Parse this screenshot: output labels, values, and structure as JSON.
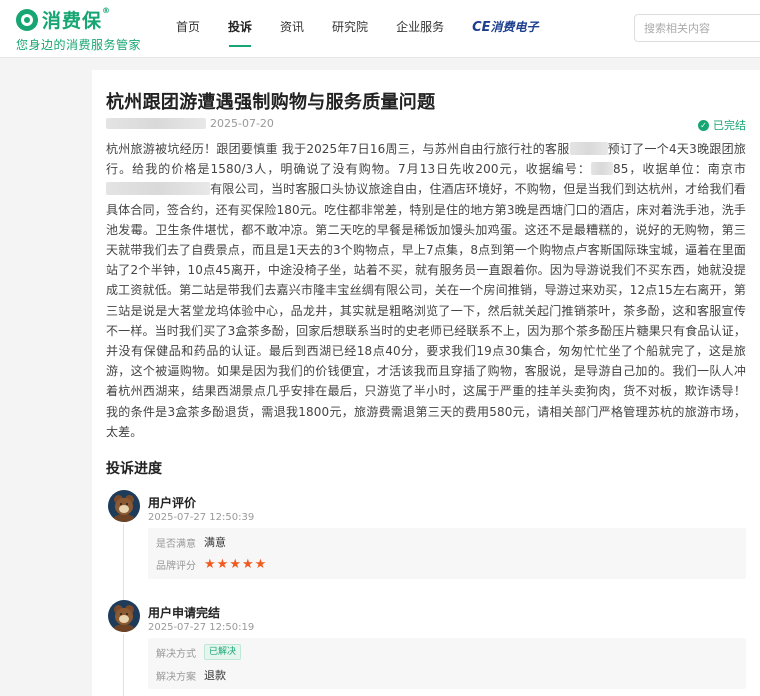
{
  "header": {
    "brand_name": "消费保",
    "brand_reg": "®",
    "slogan": "您身边的消费服务管家",
    "nav": [
      {
        "label": "首页"
      },
      {
        "label": "投诉"
      },
      {
        "label": "资讯"
      },
      {
        "label": "研究院"
      },
      {
        "label": "企业服务"
      }
    ],
    "nav_brand_ce": "CE",
    "nav_brand_label": "消费电子",
    "search_placeholder": "搜索相关内容"
  },
  "complaint": {
    "title": "杭州跟团游遭遇强制购物与服务质量问题",
    "date": "2025-07-20",
    "status": "已完结",
    "content": {
      "p1": "杭州旅游被坑经历！跟团要慎重 我于2025年7日16周三，与苏州自由行旅行社的客服",
      "p2": "预订了一个4天3晚跟团旅行。给我的价格是1580/3人，明确说了没有购物。7月13日先收200元，收据编号：",
      "p3": "85，收据单位：南京市",
      "p4": "有限公司，当时客服口头协议旅途自由，住酒店环境好，不购物，但是当我们到达杭州，才给我们看具体合同，签合约，还有买保险180元。吃住都非常差，特别是住的地方第3晚是西塘门口的酒店，床对着洗手池，洗手池发霉。卫生条件堪忧，都不敢冲凉。第二天吃的早餐是稀饭加馒头加鸡蛋。这还不是最糟糕的，说好的无购物，第三天就带我们去了自费景点，而且是1天去的3个购物点，早上7点集，8点到第一个购物点卢客斯国际珠宝城，逼着在里面站了2个半钟，10点45离开，中途没椅子坐，站着不买，就有服务员一直跟着你。因为导游说我们不买东西，她就没提成工资就低。第二站是带我们去嘉兴市隆丰宝丝绸有限公司，关在一个房间推销，导游过来劝买，12点15左右离开，第三站是说是大茗堂龙坞体验中心，品龙井，其实就是粗略浏览了一下，然后就关起门推销茶叶，茶多酚，这和客服宣传不一样。当时我们买了3盒茶多酚，回家后想联系当时的史老师已经联系不上，因为那个茶多酚压片糖果只有食品认证，并没有保健品和药品的认证。最后到西湖已经18点40分，要求我们19点30集合，匆匆忙忙坐了个船就完了，这是旅游，这个被逼购物。如果是因为我们的价钱便宜，才活该我而且穿插了购物，客服说，是导游自己加的。我们一队人冲着杭州西湖来，结果西湖景点几乎安排在最后，只游览了半小时，这属于严重的挂羊头卖狗肉，货不对板，欺诈诱导！我的条件是3盒茶多酚退货，需退我1800元，旅游费需退第三天的费用580元，请相关部门严格管理苏杭的旅游市场，太差。"
    }
  },
  "progress": {
    "section_title": "投诉进度",
    "items": [
      {
        "name": "用户评价",
        "time": "2025-07-27 12:50:39",
        "row1_key": "是否满意",
        "row1_value": "满意",
        "row2_key": "品牌评分",
        "rating": 5
      },
      {
        "name": "用户申请完结",
        "time": "2025-07-27 12:50:19",
        "row1_key": "解决方式",
        "row1_tag": "已解决",
        "row2_key": "解决方案",
        "row2_value": "退款"
      }
    ]
  },
  "colors": {
    "brand": "#17a673",
    "star": "#f25a1d"
  }
}
